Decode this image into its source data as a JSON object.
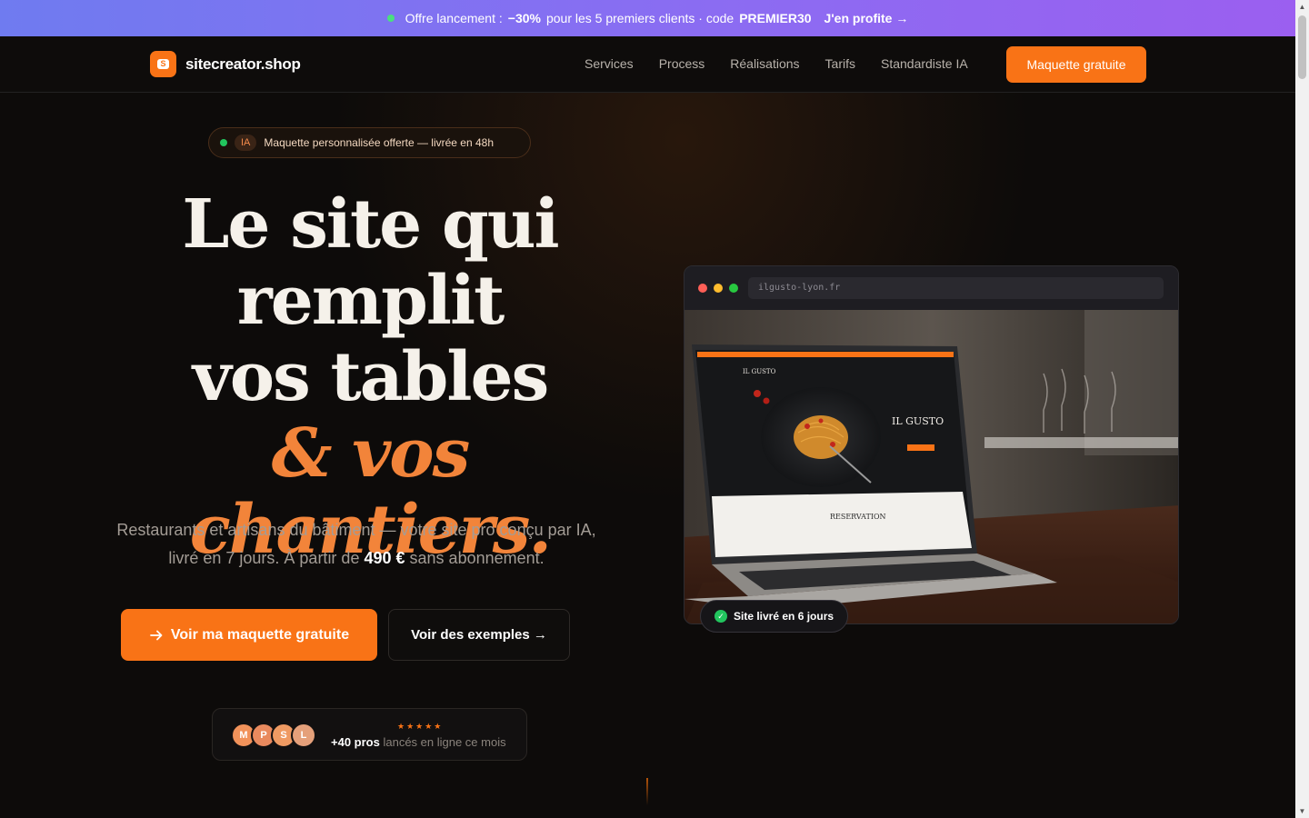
{
  "promo": {
    "lead": "Offre lancement :",
    "discount": "−30%",
    "mid": "pour les 5 premiers clients · code",
    "code": "PREMIER30",
    "cta": "J'en profite →"
  },
  "nav": {
    "logo_text": "sitecreator.shop",
    "links": [
      "Services",
      "Process",
      "Réalisations",
      "Tarifs",
      "Standardiste IA"
    ],
    "cta": "Maquette gratuite"
  },
  "hero": {
    "badge_tag": "IA",
    "badge_text": "Maquette personnalisée offerte — livrée en 48h",
    "headline_line1": "Le site qui",
    "headline_line2": "remplit",
    "headline_line3": "vos tables",
    "headline_accent": "& vos chantiers.",
    "sub_part1": "Restaurants et artisans du bâtiment — votre site pro conçu par IA, livré en 7 jours. À partir de",
    "sub_price": "490 €",
    "sub_part2": "sans abonnement.",
    "primary_cta": "Voir ma maquette gratuite",
    "secondary_cta": "Voir des exemples →"
  },
  "proof": {
    "avatars": [
      "M",
      "P",
      "S",
      "L"
    ],
    "stars": "★★★★★",
    "count": "+40 pros",
    "text": "lancés en ligne ce mois"
  },
  "preview": {
    "url": "ilgusto-lyon.fr",
    "brand": "IL GUSTO",
    "hero_title": "IL GUSTO",
    "section": "RESERVATION",
    "badge": "Site livré en 6 jours"
  },
  "colors": {
    "accent": "#f97316",
    "promo_start": "#6f7bf0",
    "promo_end": "#9b5ff0",
    "success": "#22c55e"
  }
}
